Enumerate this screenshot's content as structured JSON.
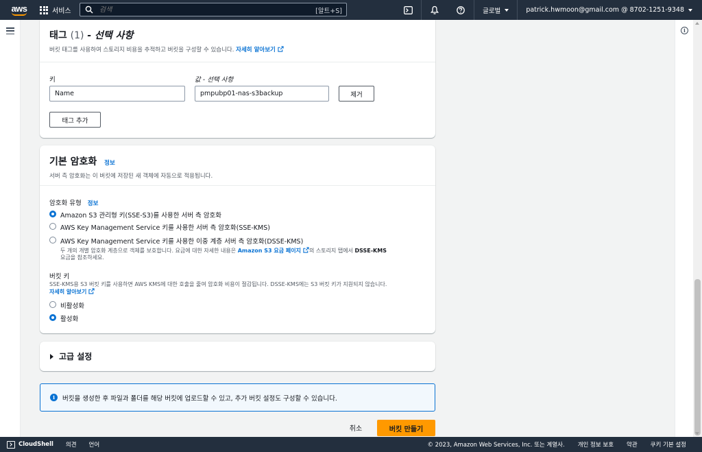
{
  "topnav": {
    "logo": "aws",
    "services": "서비스",
    "search_placeholder": "검색",
    "search_shortcut": "[알트+S]",
    "region": "글로벌",
    "account": "patrick.hwmoon@gmail.com @ 8702-1251-9348"
  },
  "tags": {
    "title": "태그",
    "count": "(1)",
    "title_suffix": "- 선택 사항",
    "desc": "버킷 태그를 사용하여 스토리지 비용을 추적하고 버킷을 구성할 수 있습니다.",
    "learn_more": "자세히 알아보기",
    "key_label": "키",
    "value_label": "값 - 선택 사항",
    "key_value": "Name",
    "value_value": "pmpubp01-nas-s3backup",
    "remove_button": "제거",
    "add_button": "태그 추가"
  },
  "encryption": {
    "title": "기본 암호화",
    "info": "정보",
    "desc": "서버 측 암호화는 이 버킷에 저장된 새 객체에 자동으로 적용됩니다.",
    "type_label": "암호화 유형",
    "type_info": "정보",
    "options": [
      {
        "label": "Amazon S3 관리형 키(SSE-S3)를 사용한 서버 측 암호화",
        "selected": true
      },
      {
        "label": "AWS Key Management Service 키를 사용한 서버 측 암호화(SSE-KMS)",
        "selected": false
      },
      {
        "label": "AWS Key Management Service 키를 사용한 이중 계층 서버 측 암호화(DSSE-KMS)",
        "selected": false
      }
    ],
    "dsse_sub_1": "두 개의 개별 암호화 계층으로 객체를 보호합니다. 요금에 대한 자세한 내용은",
    "dsse_sub_link": "Amazon S3 요금 페이지",
    "dsse_sub_2": "의 스토리지 탭에서",
    "dsse_sub_bold": "DSSE-KMS",
    "dsse_sub_3": "요금을 참조하세요.",
    "bucket_key_label": "버킷 키",
    "bucket_key_desc": "SSE-KMS용 S3 버킷 키를 사용하면 AWS KMS에 대한 호출을 줄여 암호화 비용이 절감됩니다. DSSE-KMS에는 S3 버킷 키가 지원되지 않습니다.",
    "bucket_key_learn_more": "자세히 알아보기",
    "bucket_key_options": [
      {
        "label": "비활성화",
        "selected": false
      },
      {
        "label": "활성화",
        "selected": true
      }
    ]
  },
  "advanced": {
    "label": "고급 설정"
  },
  "flash": {
    "message": "버킷을 생성한 후 파일과 폴더를 해당 버킷에 업로드할 수 있고, 추가 버킷 설정도 구성할 수 있습니다."
  },
  "actions": {
    "cancel": "취소",
    "create": "버킷 만들기"
  },
  "footer": {
    "cloudshell": "CloudShell",
    "feedback": "의견",
    "language": "언어",
    "copyright": "© 2023, Amazon Web Services, Inc. 또는 계열사.",
    "privacy": "개인 정보 보호",
    "terms": "약관",
    "cookies": "쿠키 기본 설정"
  },
  "colors": {
    "nav": "#232f3e",
    "link": "#0972d3",
    "primary": "#ff9900"
  }
}
